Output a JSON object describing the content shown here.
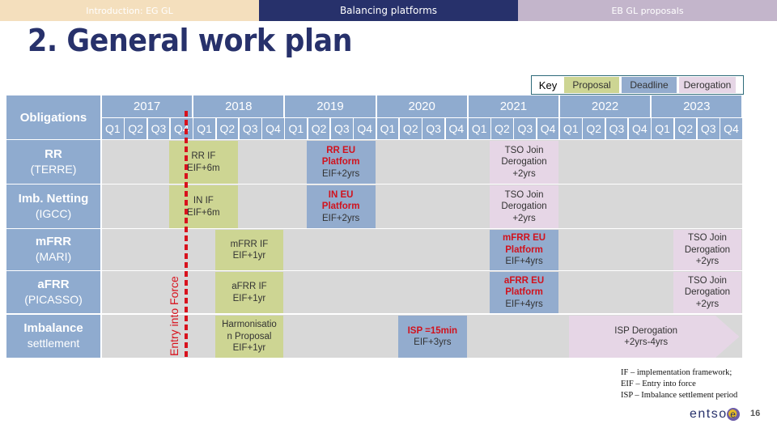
{
  "topnav": {
    "tabs": [
      {
        "label": "Introduction: EG GL"
      },
      {
        "label": "Balancing platforms",
        "active": true
      },
      {
        "label": "EB GL proposals"
      }
    ]
  },
  "title": "2. General work plan",
  "key": {
    "label": "Key",
    "items": [
      {
        "label": "Proposal",
        "color": "#cdd593"
      },
      {
        "label": "Deadline",
        "color": "#93acce"
      },
      {
        "label": "Derogation",
        "color": "#e6d6e6"
      }
    ]
  },
  "table": {
    "header_label": "Obligations",
    "years": [
      "2017",
      "2018",
      "2019",
      "2020",
      "2021",
      "2022",
      "2023"
    ],
    "quarters": [
      "Q1",
      "Q2",
      "Q3",
      "Q4"
    ],
    "rows": [
      {
        "main": "RR",
        "sub": "(TERRE)"
      },
      {
        "main": "Imb. Netting",
        "sub": "(IGCC)"
      },
      {
        "main": "mFRR",
        "sub": "(MARI)"
      },
      {
        "main": "aFRR",
        "sub": "(PICASSO)"
      },
      {
        "main": "Imbalance",
        "sub": "settlement"
      }
    ],
    "milestones": [
      {
        "row": 0,
        "type": "proposal",
        "start": "2017-Q4",
        "end": "2018-Q2",
        "red": "",
        "lines": [
          "RR IF",
          "EIF+6m"
        ]
      },
      {
        "row": 0,
        "type": "deadline",
        "start": "2019-Q2",
        "end": "2019-Q4",
        "red": "RR EU Platform",
        "lines": [
          "EIF+2yrs"
        ]
      },
      {
        "row": 0,
        "type": "derogation",
        "start": "2021-Q2",
        "end": "2021-Q4",
        "red": "",
        "lines": [
          "TSO Join",
          "Derogation",
          "+2yrs"
        ]
      },
      {
        "row": 1,
        "type": "proposal",
        "start": "2017-Q4",
        "end": "2018-Q2",
        "red": "",
        "lines": [
          "IN IF",
          "EIF+6m"
        ]
      },
      {
        "row": 1,
        "type": "deadline",
        "start": "2019-Q2",
        "end": "2019-Q4",
        "red": "IN EU Platform",
        "lines": [
          "EIF+2yrs"
        ]
      },
      {
        "row": 1,
        "type": "derogation",
        "start": "2021-Q2",
        "end": "2021-Q4",
        "red": "",
        "lines": [
          "TSO Join",
          "Derogation",
          "+2yrs"
        ]
      },
      {
        "row": 2,
        "type": "proposal",
        "start": "2018-Q2",
        "end": "2018-Q4",
        "red": "",
        "lines": [
          "mFRR IF",
          "EIF+1yr"
        ]
      },
      {
        "row": 2,
        "type": "deadline",
        "start": "2021-Q2",
        "end": "2021-Q4",
        "red": "mFRR EU Platform",
        "lines": [
          "EIF+4yrs"
        ]
      },
      {
        "row": 2,
        "type": "derogation",
        "start": "2023-Q2",
        "end": "2023-Q4",
        "red": "",
        "lines": [
          "TSO Join",
          "Derogation",
          "+2yrs"
        ]
      },
      {
        "row": 3,
        "type": "proposal",
        "start": "2018-Q2",
        "end": "2018-Q4",
        "red": "",
        "lines": [
          "aFRR IF",
          "EIF+1yr"
        ]
      },
      {
        "row": 3,
        "type": "deadline",
        "start": "2021-Q2",
        "end": "2021-Q4",
        "red": "aFRR EU Platform",
        "lines": [
          "EIF+4yrs"
        ]
      },
      {
        "row": 3,
        "type": "derogation",
        "start": "2023-Q2",
        "end": "2023-Q4",
        "red": "",
        "lines": [
          "TSO Join",
          "Derogation",
          "+2yrs"
        ]
      },
      {
        "row": 4,
        "type": "proposal",
        "start": "2018-Q2",
        "end": "2018-Q4",
        "red": "",
        "lines": [
          "Harmonisatio",
          "n Proposal",
          "EIF+1yr"
        ]
      },
      {
        "row": 4,
        "type": "deadline",
        "start": "2020-Q2",
        "end": "2020-Q4",
        "red": "ISP =15min",
        "lines": [
          "EIF+3yrs"
        ]
      },
      {
        "row": 4,
        "type": "derogation-arrow",
        "start": "2022-Q1",
        "end": "2023-Q4",
        "red": "",
        "lines": [
          "ISP Derogation",
          "+2yrs-4yrs"
        ]
      }
    ],
    "marker_label": "Entry into Force"
  },
  "footnote": [
    "IF – implementation framework;",
    "EIF – Entry into force",
    "ISP – Imbalance settlement period"
  ],
  "logo": {
    "text": "entso",
    "e": "e"
  },
  "page_number": "16"
}
